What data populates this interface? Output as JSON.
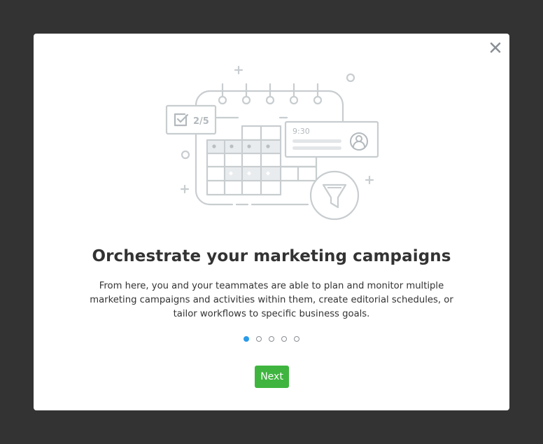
{
  "dialog": {
    "title": "Orchestrate your marketing campaigns",
    "description": "From here, you and your teammates are able to plan and monitor multiple marketing campaigns and activities within them, create editorial schedules, or tailor workflows to specific business goals.",
    "close_icon": "close-icon",
    "next_label": "Next",
    "pagination": {
      "total": 5,
      "current": 1
    },
    "illustration": {
      "task_counter": "2/5",
      "time_label": "9:30",
      "icons": [
        "calendar-icon",
        "checkbox-icon",
        "user-avatar-icon",
        "funnel-icon"
      ]
    }
  },
  "colors": {
    "backdrop": "#333333",
    "modal": "#ffffff",
    "accent_blue": "#2a9be8",
    "button_green": "#3fb53f",
    "illustration_gray": "#c8cdd0"
  }
}
